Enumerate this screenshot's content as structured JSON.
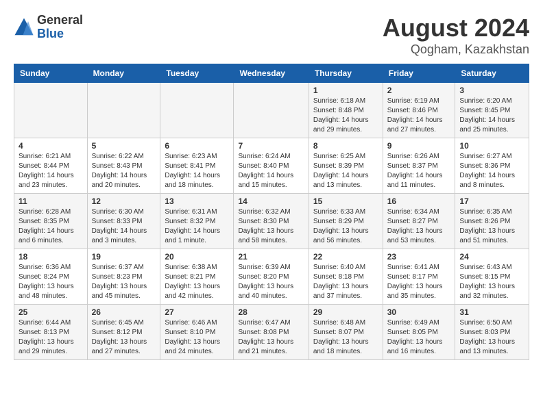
{
  "header": {
    "logo_general": "General",
    "logo_blue": "Blue",
    "month_title": "August 2024",
    "location": "Qogham, Kazakhstan"
  },
  "days_of_week": [
    "Sunday",
    "Monday",
    "Tuesday",
    "Wednesday",
    "Thursday",
    "Friday",
    "Saturday"
  ],
  "weeks": [
    [
      {
        "day": "",
        "info": ""
      },
      {
        "day": "",
        "info": ""
      },
      {
        "day": "",
        "info": ""
      },
      {
        "day": "",
        "info": ""
      },
      {
        "day": "1",
        "info": "Sunrise: 6:18 AM\nSunset: 8:48 PM\nDaylight: 14 hours\nand 29 minutes."
      },
      {
        "day": "2",
        "info": "Sunrise: 6:19 AM\nSunset: 8:46 PM\nDaylight: 14 hours\nand 27 minutes."
      },
      {
        "day": "3",
        "info": "Sunrise: 6:20 AM\nSunset: 8:45 PM\nDaylight: 14 hours\nand 25 minutes."
      }
    ],
    [
      {
        "day": "4",
        "info": "Sunrise: 6:21 AM\nSunset: 8:44 PM\nDaylight: 14 hours\nand 23 minutes."
      },
      {
        "day": "5",
        "info": "Sunrise: 6:22 AM\nSunset: 8:43 PM\nDaylight: 14 hours\nand 20 minutes."
      },
      {
        "day": "6",
        "info": "Sunrise: 6:23 AM\nSunset: 8:41 PM\nDaylight: 14 hours\nand 18 minutes."
      },
      {
        "day": "7",
        "info": "Sunrise: 6:24 AM\nSunset: 8:40 PM\nDaylight: 14 hours\nand 15 minutes."
      },
      {
        "day": "8",
        "info": "Sunrise: 6:25 AM\nSunset: 8:39 PM\nDaylight: 14 hours\nand 13 minutes."
      },
      {
        "day": "9",
        "info": "Sunrise: 6:26 AM\nSunset: 8:37 PM\nDaylight: 14 hours\nand 11 minutes."
      },
      {
        "day": "10",
        "info": "Sunrise: 6:27 AM\nSunset: 8:36 PM\nDaylight: 14 hours\nand 8 minutes."
      }
    ],
    [
      {
        "day": "11",
        "info": "Sunrise: 6:28 AM\nSunset: 8:35 PM\nDaylight: 14 hours\nand 6 minutes."
      },
      {
        "day": "12",
        "info": "Sunrise: 6:30 AM\nSunset: 8:33 PM\nDaylight: 14 hours\nand 3 minutes."
      },
      {
        "day": "13",
        "info": "Sunrise: 6:31 AM\nSunset: 8:32 PM\nDaylight: 14 hours\nand 1 minute."
      },
      {
        "day": "14",
        "info": "Sunrise: 6:32 AM\nSunset: 8:30 PM\nDaylight: 13 hours\nand 58 minutes."
      },
      {
        "day": "15",
        "info": "Sunrise: 6:33 AM\nSunset: 8:29 PM\nDaylight: 13 hours\nand 56 minutes."
      },
      {
        "day": "16",
        "info": "Sunrise: 6:34 AM\nSunset: 8:27 PM\nDaylight: 13 hours\nand 53 minutes."
      },
      {
        "day": "17",
        "info": "Sunrise: 6:35 AM\nSunset: 8:26 PM\nDaylight: 13 hours\nand 51 minutes."
      }
    ],
    [
      {
        "day": "18",
        "info": "Sunrise: 6:36 AM\nSunset: 8:24 PM\nDaylight: 13 hours\nand 48 minutes."
      },
      {
        "day": "19",
        "info": "Sunrise: 6:37 AM\nSunset: 8:23 PM\nDaylight: 13 hours\nand 45 minutes."
      },
      {
        "day": "20",
        "info": "Sunrise: 6:38 AM\nSunset: 8:21 PM\nDaylight: 13 hours\nand 42 minutes."
      },
      {
        "day": "21",
        "info": "Sunrise: 6:39 AM\nSunset: 8:20 PM\nDaylight: 13 hours\nand 40 minutes."
      },
      {
        "day": "22",
        "info": "Sunrise: 6:40 AM\nSunset: 8:18 PM\nDaylight: 13 hours\nand 37 minutes."
      },
      {
        "day": "23",
        "info": "Sunrise: 6:41 AM\nSunset: 8:17 PM\nDaylight: 13 hours\nand 35 minutes."
      },
      {
        "day": "24",
        "info": "Sunrise: 6:43 AM\nSunset: 8:15 PM\nDaylight: 13 hours\nand 32 minutes."
      }
    ],
    [
      {
        "day": "25",
        "info": "Sunrise: 6:44 AM\nSunset: 8:13 PM\nDaylight: 13 hours\nand 29 minutes."
      },
      {
        "day": "26",
        "info": "Sunrise: 6:45 AM\nSunset: 8:12 PM\nDaylight: 13 hours\nand 27 minutes."
      },
      {
        "day": "27",
        "info": "Sunrise: 6:46 AM\nSunset: 8:10 PM\nDaylight: 13 hours\nand 24 minutes."
      },
      {
        "day": "28",
        "info": "Sunrise: 6:47 AM\nSunset: 8:08 PM\nDaylight: 13 hours\nand 21 minutes."
      },
      {
        "day": "29",
        "info": "Sunrise: 6:48 AM\nSunset: 8:07 PM\nDaylight: 13 hours\nand 18 minutes."
      },
      {
        "day": "30",
        "info": "Sunrise: 6:49 AM\nSunset: 8:05 PM\nDaylight: 13 hours\nand 16 minutes."
      },
      {
        "day": "31",
        "info": "Sunrise: 6:50 AM\nSunset: 8:03 PM\nDaylight: 13 hours\nand 13 minutes."
      }
    ]
  ]
}
